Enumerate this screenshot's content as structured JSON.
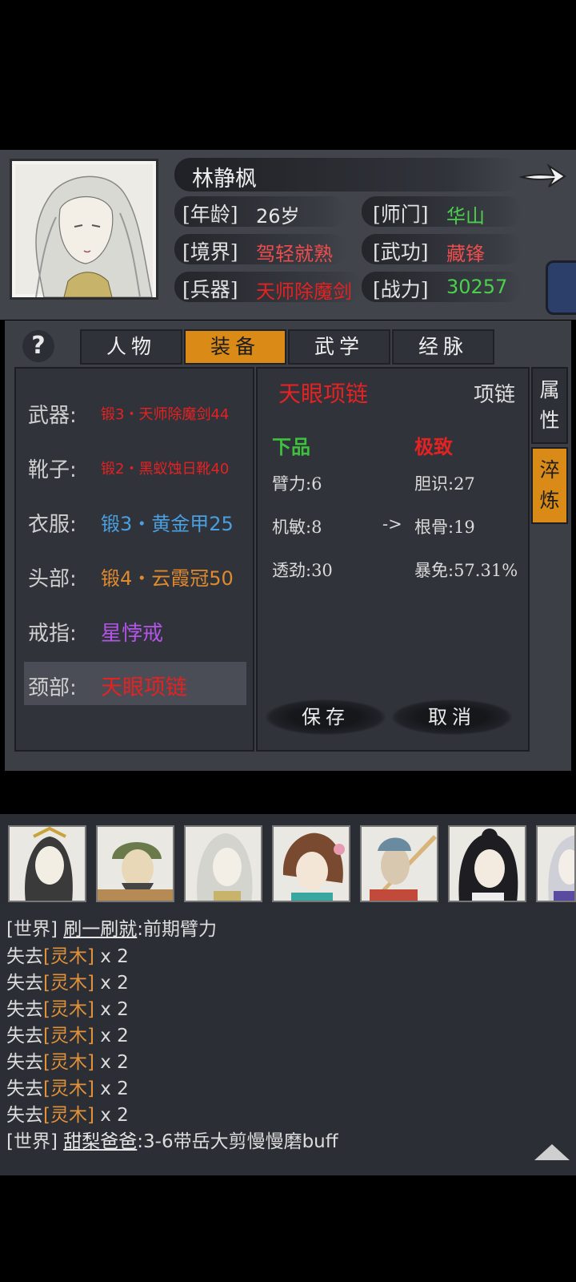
{
  "character": {
    "name": "林静枫",
    "stats": {
      "age_label": "[年龄]",
      "age_value": "26岁",
      "sect_label": "[师门]",
      "sect_value": "华山",
      "realm_label": "[境界]",
      "realm_value": "驾轻就熟",
      "skill_label": "[武功]",
      "skill_value": "藏锋",
      "weapon_label": "[兵器]",
      "weapon_value": "天师除魔剑",
      "power_label": "[战力]",
      "power_value": "30257"
    }
  },
  "tabs": [
    "人物",
    "装备",
    "武学",
    "经脉"
  ],
  "active_tab": "装备",
  "help_symbol": "?",
  "equipment": [
    {
      "slot": "武器:",
      "item": "锻3・天师除魔剑44",
      "color": "#e52222"
    },
    {
      "slot": "靴子:",
      "item": "锻2・黑蚁蚀日靴40",
      "color": "#e52222"
    },
    {
      "slot": "衣服:",
      "item": "锻3・黄金甲25",
      "color": "#4a9fe0"
    },
    {
      "slot": "头部:",
      "item": "锻4・云霞冠50",
      "color": "#e08a2e"
    },
    {
      "slot": "戒指:",
      "item": "星悖戒",
      "color": "#b254e6"
    },
    {
      "slot": "颈部:",
      "item": "天眼项链",
      "color": "#e52222"
    }
  ],
  "detail": {
    "name": "天眼项链",
    "type": "项链",
    "grade_current": "下品",
    "grade_target": "极致",
    "left_attrs": [
      "臂力:6",
      "机敏:8",
      "透劲:30"
    ],
    "right_attrs": [
      "胆识:27",
      "根骨:19",
      "暴免:57.31%"
    ],
    "arrow": "->",
    "save": "保存",
    "cancel": "取消"
  },
  "side_tabs": [
    "属性",
    "淬炼"
  ],
  "chat": {
    "line1_tag": "[世界]",
    "line1_user": "刷一刷就",
    "line1_msg": ":前期臂力",
    "loss_prefix": "失去",
    "loss_item": "[灵木]",
    "loss_count": " x 2",
    "line_last_tag": "[世界]",
    "line_last_user": "甜梨爸爸",
    "line_last_msg": ":3-6带岳大剪慢慢磨buff"
  },
  "colors": {
    "accent": "#d98a17",
    "sect": "#4ad04a",
    "realm": "#ee4d4d",
    "power": "#4ad04a",
    "grade_current": "#3ec23e",
    "grade_target": "#e52222"
  }
}
